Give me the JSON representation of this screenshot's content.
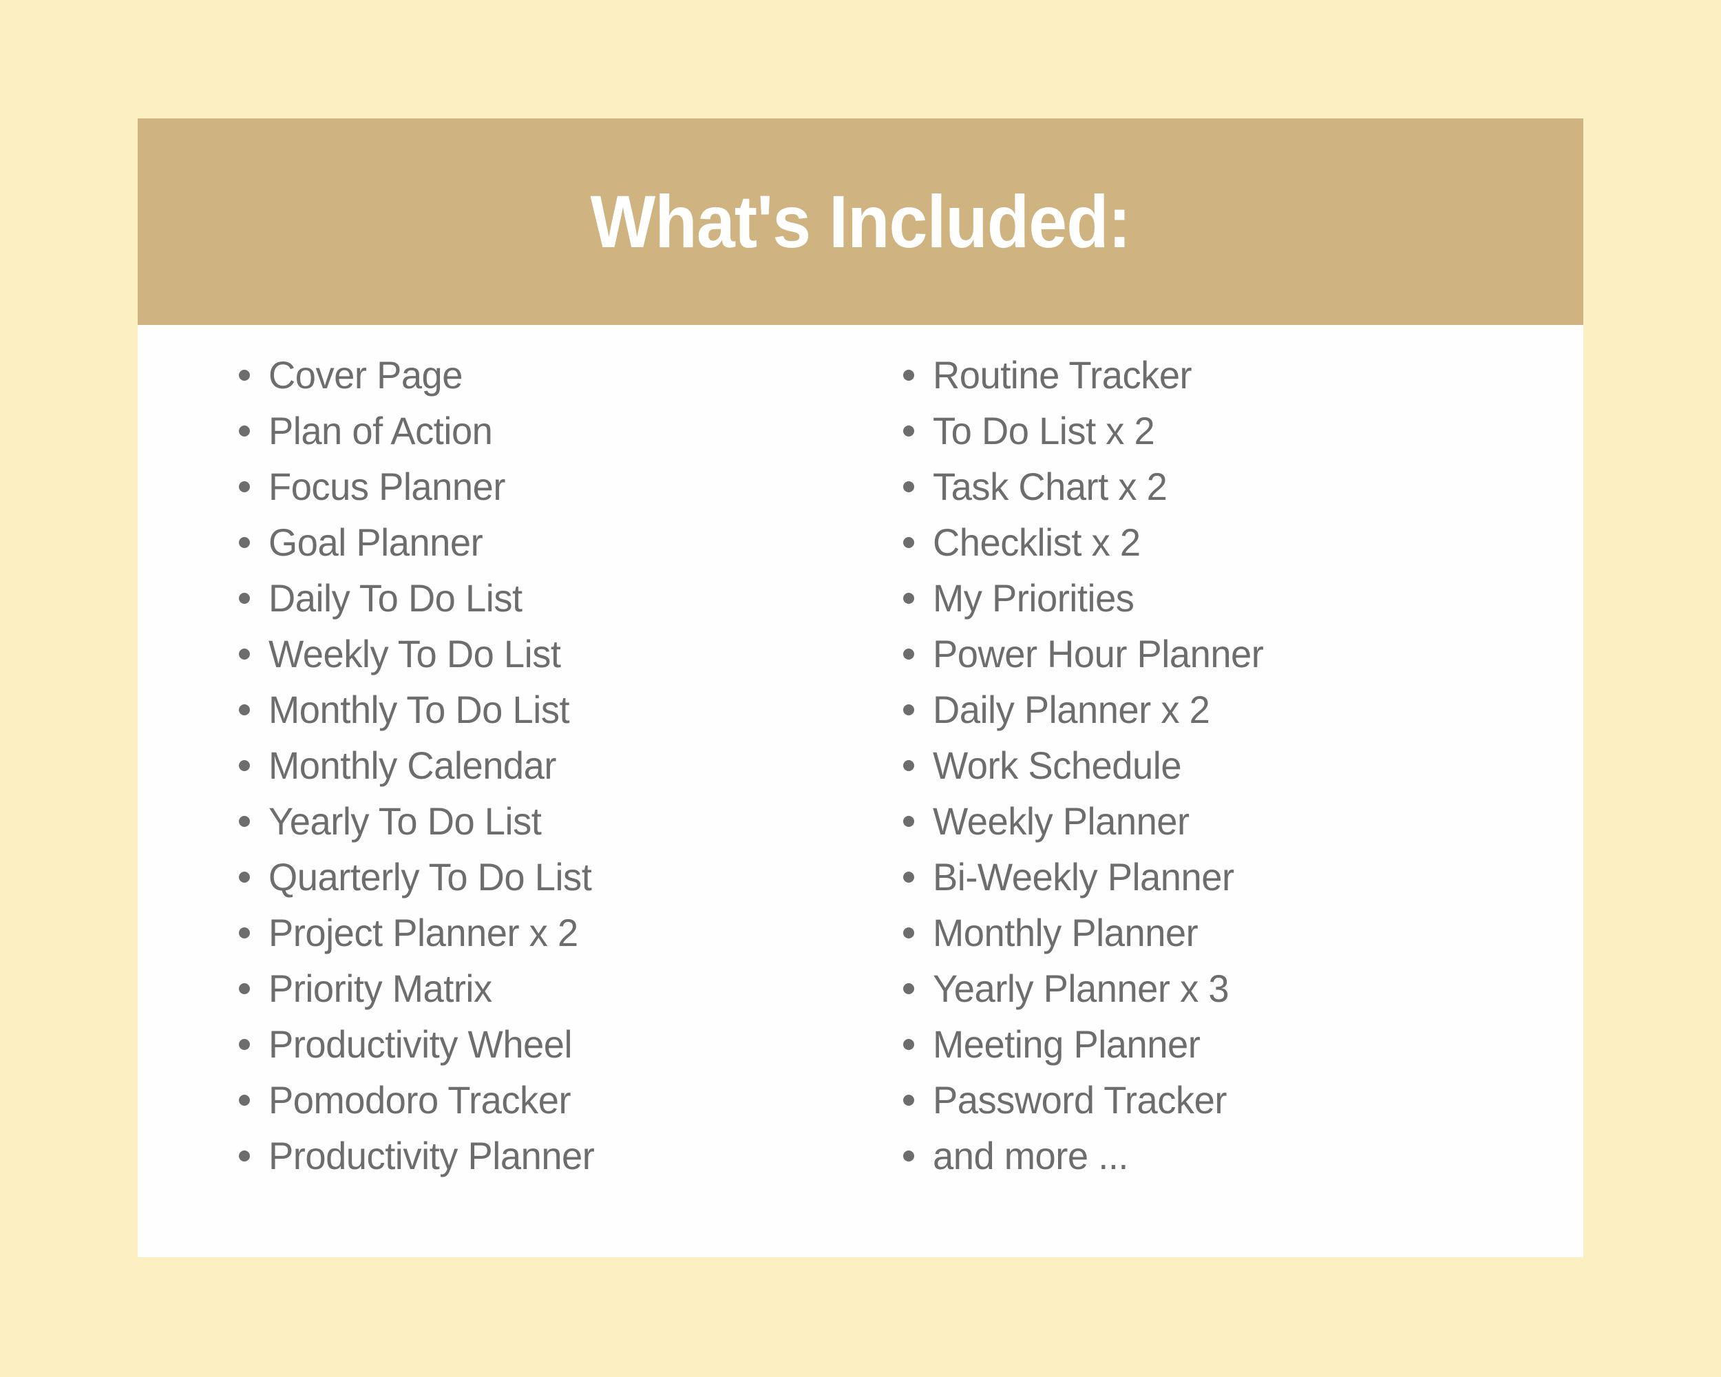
{
  "page": {
    "background_color": "#FCEFC2"
  },
  "card": {
    "background_color": "#FDFEFD",
    "header": {
      "background_color": "#CFB380",
      "title": "What's Included:",
      "title_color": "#FFFFFF"
    },
    "list_text_color": "#6D6D6D",
    "bullet_color": "#6D6D6D",
    "columns": [
      {
        "name": "left-column",
        "items": [
          "Cover Page",
          "Plan of Action",
          "Focus Planner",
          "Goal Planner",
          "Daily To Do List",
          "Weekly To Do List",
          "Monthly To Do List",
          "Monthly Calendar",
          "Yearly To Do List",
          "Quarterly To Do List",
          "Project Planner x 2",
          "Priority Matrix",
          "Productivity Wheel",
          "Pomodoro Tracker",
          "Productivity Planner"
        ]
      },
      {
        "name": "right-column",
        "items": [
          "Routine Tracker",
          "To Do List x 2",
          "Task Chart x 2",
          "Checklist x 2",
          "My Priorities",
          "Power Hour Planner",
          "Daily Planner x 2",
          "Work Schedule",
          "Weekly Planner",
          "Bi-Weekly Planner",
          "Monthly Planner",
          "Yearly Planner x 3",
          "Meeting Planner",
          "Password Tracker",
          "and more ..."
        ]
      }
    ]
  }
}
